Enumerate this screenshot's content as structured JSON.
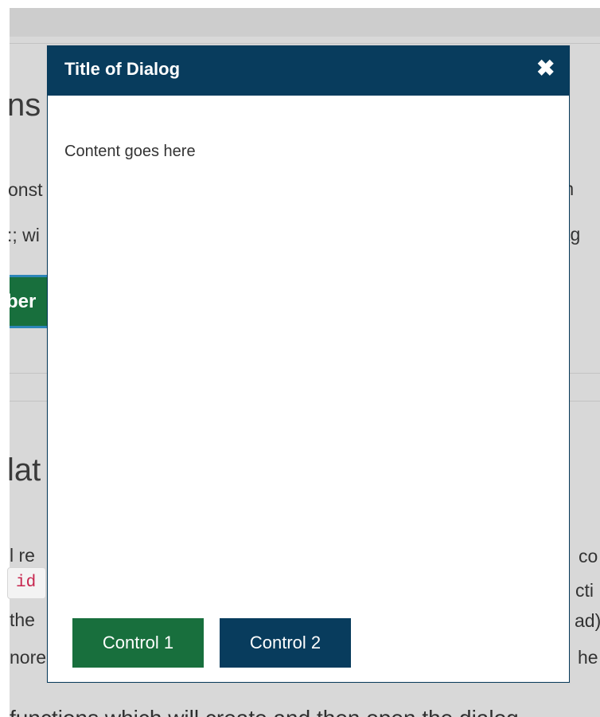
{
  "background": {
    "title_top": "ns",
    "title_bottom": "lat",
    "paragraph_lines_left": [
      "onst",
      ":; wi",
      "l re",
      "the",
      "nore"
    ],
    "paragraph_lines_right": [
      "m",
      "kg",
      "co",
      "cti",
      "ad)",
      "he"
    ],
    "code_token": "id",
    "button_label": "ber",
    "bottom_line": "functions which will create and then open the dialog"
  },
  "dialog": {
    "title": "Title of Dialog",
    "close_symbol": "✖",
    "content": "Content goes here",
    "buttons": {
      "control_1": "Control 1",
      "control_2": "Control 2"
    },
    "colors": {
      "header": "#083c5d",
      "control_1": "#186f3d",
      "control_2": "#083c5d"
    }
  }
}
